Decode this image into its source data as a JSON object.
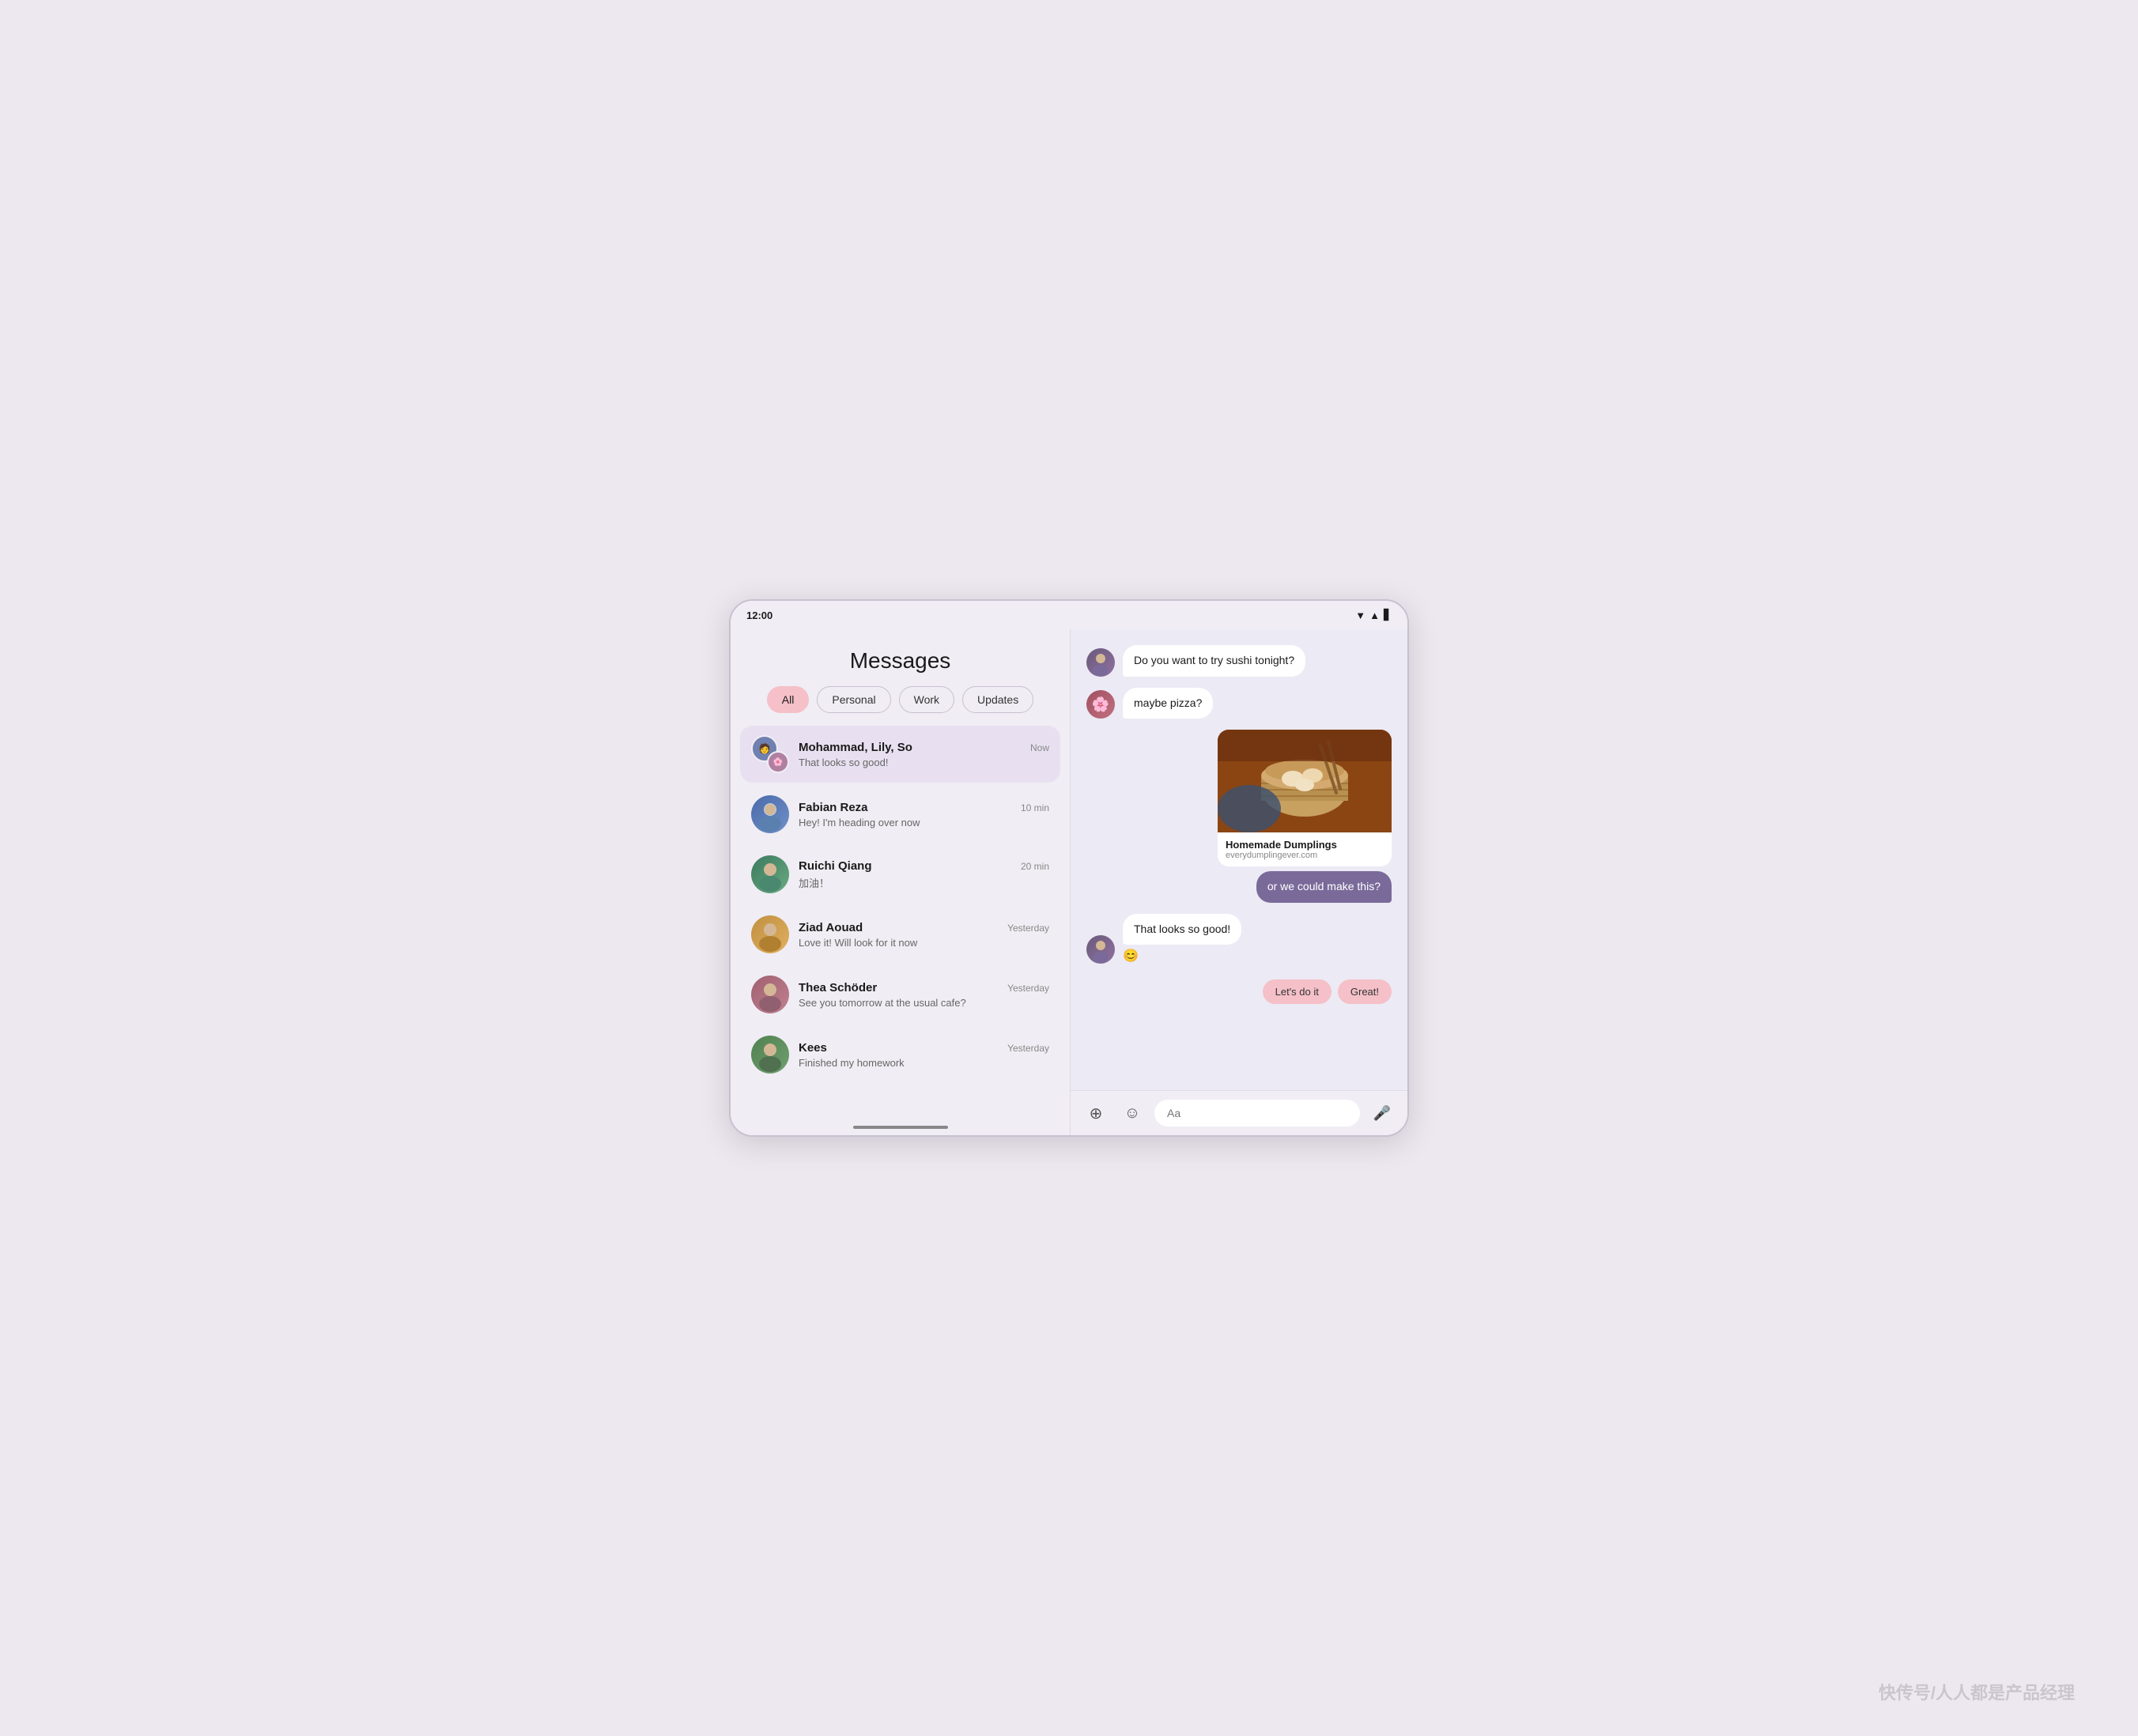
{
  "statusBar": {
    "time": "12:00"
  },
  "leftPanel": {
    "title": "Messages",
    "filters": [
      {
        "label": "All",
        "active": true
      },
      {
        "label": "Personal",
        "active": false
      },
      {
        "label": "Work",
        "active": false
      },
      {
        "label": "Updates",
        "active": false
      }
    ],
    "conversations": [
      {
        "id": 1,
        "name": "Mohammad, Lily, So",
        "preview": "That looks so good!",
        "time": "Now",
        "active": true,
        "avatar_type": "group"
      },
      {
        "id": 2,
        "name": "Fabian Reza",
        "preview": "Hey! I'm heading over now",
        "time": "10 min",
        "active": false,
        "avatar_type": "single",
        "avatar_color": "#5a7ab0"
      },
      {
        "id": 3,
        "name": "Ruichi Qiang",
        "preview": "加油！",
        "time": "20 min",
        "active": false,
        "avatar_type": "single",
        "avatar_color": "#4a8a70"
      },
      {
        "id": 4,
        "name": "Ziad Aouad",
        "preview": "Love it! Will look for it now",
        "time": "Yesterday",
        "active": false,
        "avatar_type": "single",
        "avatar_color": "#c09040"
      },
      {
        "id": 5,
        "name": "Thea Schöder",
        "preview": "See you tomorrow at the usual cafe?",
        "time": "Yesterday",
        "active": false,
        "avatar_type": "single",
        "avatar_color": "#a06070"
      },
      {
        "id": 6,
        "name": "Kees",
        "preview": "Finished my homework",
        "time": "Yesterday",
        "active": false,
        "avatar_type": "single",
        "avatar_color": "#508050"
      }
    ]
  },
  "rightPanel": {
    "messages": [
      {
        "id": 1,
        "type": "incoming",
        "text": "Do you want to try sushi tonight?",
        "hasAvatar": true,
        "avatarEmoji": "🧑"
      },
      {
        "id": 2,
        "type": "incoming",
        "text": "maybe pizza?",
        "hasAvatar": true,
        "avatarEmoji": "🌸"
      },
      {
        "id": 3,
        "type": "outgoing-card",
        "cardTitle": "Homemade Dumplings",
        "cardUrl": "everydumplingever.com",
        "bubbleText": "or we could make this?"
      },
      {
        "id": 4,
        "type": "incoming",
        "text": "That looks so good!",
        "hasAvatar": true,
        "avatarEmoji": "🧑",
        "reaction": "😊"
      }
    ],
    "quickReplies": [
      "Let's do it",
      "Great!"
    ],
    "inputPlaceholder": "Aa"
  },
  "watermark": "快传号/人人都是产品经理"
}
